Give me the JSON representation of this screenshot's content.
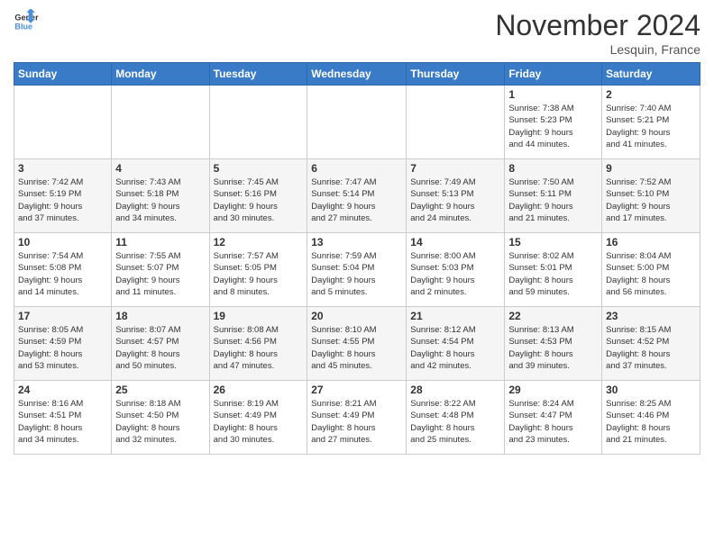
{
  "logo": {
    "line1": "General",
    "line2": "Blue"
  },
  "title": "November 2024",
  "location": "Lesquin, France",
  "headers": [
    "Sunday",
    "Monday",
    "Tuesday",
    "Wednesday",
    "Thursday",
    "Friday",
    "Saturday"
  ],
  "weeks": [
    [
      {
        "day": "",
        "info": ""
      },
      {
        "day": "",
        "info": ""
      },
      {
        "day": "",
        "info": ""
      },
      {
        "day": "",
        "info": ""
      },
      {
        "day": "",
        "info": ""
      },
      {
        "day": "1",
        "info": "Sunrise: 7:38 AM\nSunset: 5:23 PM\nDaylight: 9 hours\nand 44 minutes."
      },
      {
        "day": "2",
        "info": "Sunrise: 7:40 AM\nSunset: 5:21 PM\nDaylight: 9 hours\nand 41 minutes."
      }
    ],
    [
      {
        "day": "3",
        "info": "Sunrise: 7:42 AM\nSunset: 5:19 PM\nDaylight: 9 hours\nand 37 minutes."
      },
      {
        "day": "4",
        "info": "Sunrise: 7:43 AM\nSunset: 5:18 PM\nDaylight: 9 hours\nand 34 minutes."
      },
      {
        "day": "5",
        "info": "Sunrise: 7:45 AM\nSunset: 5:16 PM\nDaylight: 9 hours\nand 30 minutes."
      },
      {
        "day": "6",
        "info": "Sunrise: 7:47 AM\nSunset: 5:14 PM\nDaylight: 9 hours\nand 27 minutes."
      },
      {
        "day": "7",
        "info": "Sunrise: 7:49 AM\nSunset: 5:13 PM\nDaylight: 9 hours\nand 24 minutes."
      },
      {
        "day": "8",
        "info": "Sunrise: 7:50 AM\nSunset: 5:11 PM\nDaylight: 9 hours\nand 21 minutes."
      },
      {
        "day": "9",
        "info": "Sunrise: 7:52 AM\nSunset: 5:10 PM\nDaylight: 9 hours\nand 17 minutes."
      }
    ],
    [
      {
        "day": "10",
        "info": "Sunrise: 7:54 AM\nSunset: 5:08 PM\nDaylight: 9 hours\nand 14 minutes."
      },
      {
        "day": "11",
        "info": "Sunrise: 7:55 AM\nSunset: 5:07 PM\nDaylight: 9 hours\nand 11 minutes."
      },
      {
        "day": "12",
        "info": "Sunrise: 7:57 AM\nSunset: 5:05 PM\nDaylight: 9 hours\nand 8 minutes."
      },
      {
        "day": "13",
        "info": "Sunrise: 7:59 AM\nSunset: 5:04 PM\nDaylight: 9 hours\nand 5 minutes."
      },
      {
        "day": "14",
        "info": "Sunrise: 8:00 AM\nSunset: 5:03 PM\nDaylight: 9 hours\nand 2 minutes."
      },
      {
        "day": "15",
        "info": "Sunrise: 8:02 AM\nSunset: 5:01 PM\nDaylight: 8 hours\nand 59 minutes."
      },
      {
        "day": "16",
        "info": "Sunrise: 8:04 AM\nSunset: 5:00 PM\nDaylight: 8 hours\nand 56 minutes."
      }
    ],
    [
      {
        "day": "17",
        "info": "Sunrise: 8:05 AM\nSunset: 4:59 PM\nDaylight: 8 hours\nand 53 minutes."
      },
      {
        "day": "18",
        "info": "Sunrise: 8:07 AM\nSunset: 4:57 PM\nDaylight: 8 hours\nand 50 minutes."
      },
      {
        "day": "19",
        "info": "Sunrise: 8:08 AM\nSunset: 4:56 PM\nDaylight: 8 hours\nand 47 minutes."
      },
      {
        "day": "20",
        "info": "Sunrise: 8:10 AM\nSunset: 4:55 PM\nDaylight: 8 hours\nand 45 minutes."
      },
      {
        "day": "21",
        "info": "Sunrise: 8:12 AM\nSunset: 4:54 PM\nDaylight: 8 hours\nand 42 minutes."
      },
      {
        "day": "22",
        "info": "Sunrise: 8:13 AM\nSunset: 4:53 PM\nDaylight: 8 hours\nand 39 minutes."
      },
      {
        "day": "23",
        "info": "Sunrise: 8:15 AM\nSunset: 4:52 PM\nDaylight: 8 hours\nand 37 minutes."
      }
    ],
    [
      {
        "day": "24",
        "info": "Sunrise: 8:16 AM\nSunset: 4:51 PM\nDaylight: 8 hours\nand 34 minutes."
      },
      {
        "day": "25",
        "info": "Sunrise: 8:18 AM\nSunset: 4:50 PM\nDaylight: 8 hours\nand 32 minutes."
      },
      {
        "day": "26",
        "info": "Sunrise: 8:19 AM\nSunset: 4:49 PM\nDaylight: 8 hours\nand 30 minutes."
      },
      {
        "day": "27",
        "info": "Sunrise: 8:21 AM\nSunset: 4:49 PM\nDaylight: 8 hours\nand 27 minutes."
      },
      {
        "day": "28",
        "info": "Sunrise: 8:22 AM\nSunset: 4:48 PM\nDaylight: 8 hours\nand 25 minutes."
      },
      {
        "day": "29",
        "info": "Sunrise: 8:24 AM\nSunset: 4:47 PM\nDaylight: 8 hours\nand 23 minutes."
      },
      {
        "day": "30",
        "info": "Sunrise: 8:25 AM\nSunset: 4:46 PM\nDaylight: 8 hours\nand 21 minutes."
      }
    ]
  ]
}
